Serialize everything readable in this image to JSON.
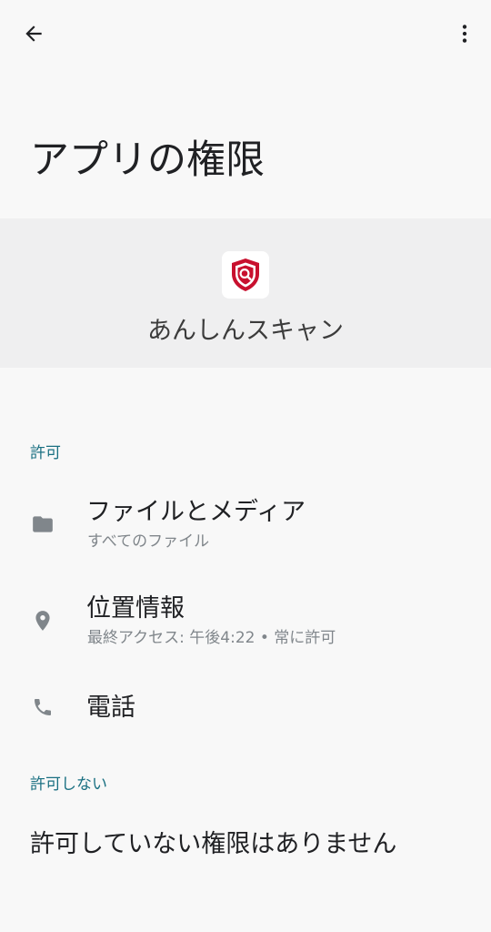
{
  "toolbar": {
    "back_icon": "arrow-back-icon",
    "more_icon": "more-vert-icon"
  },
  "page": {
    "title": "アプリの権限"
  },
  "app": {
    "name": "あんしんスキャン",
    "icon": "shield-search-icon",
    "icon_color": "#c8102e"
  },
  "sections": {
    "allowed_label": "許可",
    "denied_label": "許可しない"
  },
  "permissions": [
    {
      "icon": "folder-icon",
      "title": "ファイルとメディア",
      "subtitle": "すべてのファイル"
    },
    {
      "icon": "location-pin-icon",
      "title": "位置情報",
      "subtitle": "最終アクセス: 午後4:22 • 常に許可"
    },
    {
      "icon": "phone-icon",
      "title": "電話"
    }
  ],
  "denied": {
    "empty_text": "許可していない権限はありません"
  },
  "colors": {
    "accent": "#1a7082",
    "background": "#f8f8f8",
    "header_band": "#efeff0",
    "secondary_text": "#80868b",
    "icon_gray": "#80868b"
  }
}
